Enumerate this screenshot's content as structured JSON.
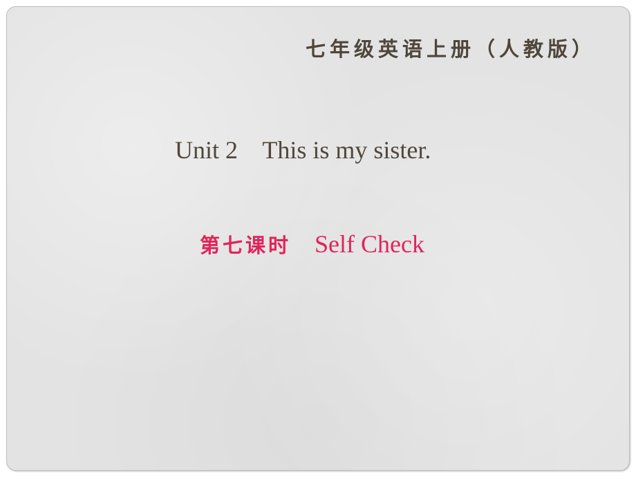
{
  "slide": {
    "header_title": "七年级英语上册（人教版）",
    "unit_title": "Unit 2    This is my sister.",
    "lesson": {
      "number": "第七课时",
      "name": "Self Check"
    }
  },
  "colors": {
    "background": "#e3e3e3",
    "title_text": "#4f463b",
    "accent": "#e0245a"
  }
}
